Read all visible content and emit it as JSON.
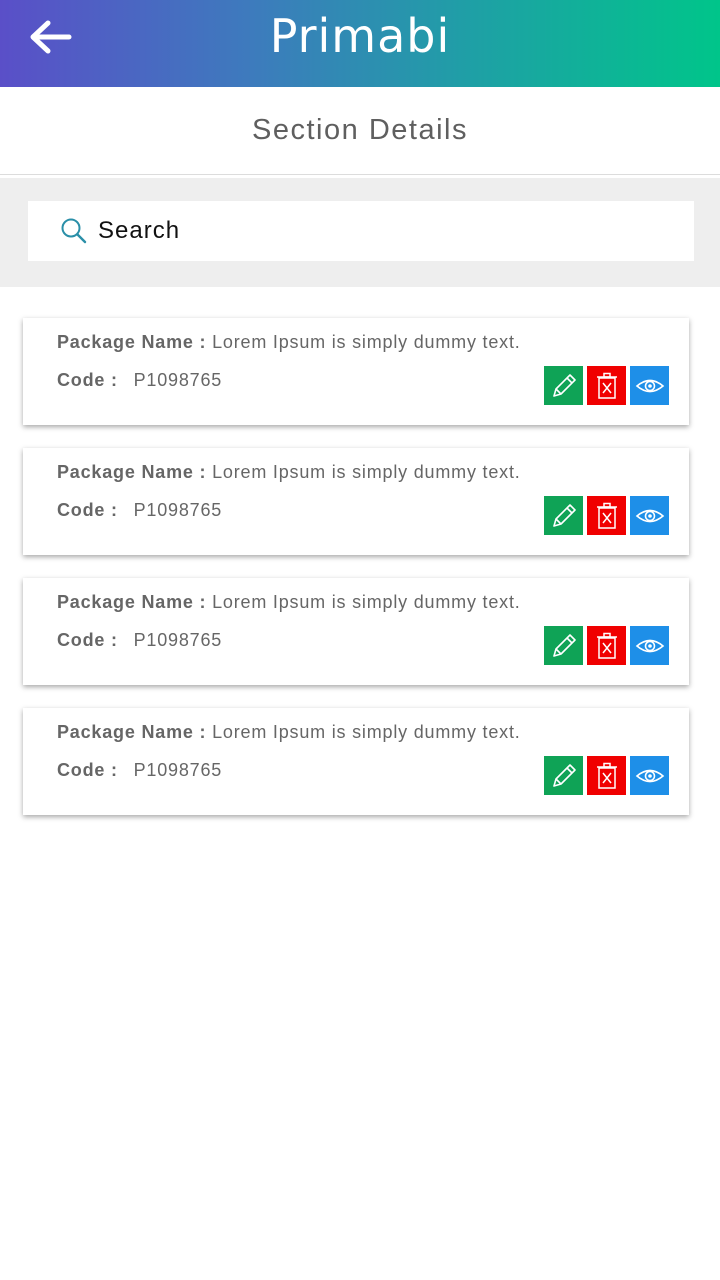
{
  "header": {
    "logo_text": "Primabi",
    "back_icon": "arrow-left-icon",
    "gradient": [
      "#5a4fc8",
      "#00c58a"
    ]
  },
  "page": {
    "title": "Section Details"
  },
  "search": {
    "placeholder": "Search",
    "value": "",
    "icon": "search-icon"
  },
  "labels": {
    "package_name": "Package Name :",
    "code": "Code :"
  },
  "actions": {
    "edit_color": "#0fa356",
    "delete_color": "#f00000",
    "view_color": "#1e8fe8",
    "edit_icon": "pencil-icon",
    "delete_icon": "trash-icon",
    "view_icon": "eye-icon"
  },
  "items": [
    {
      "package_name": "Lorem Ipsum is simply dummy text.",
      "code": "P1098765"
    },
    {
      "package_name": "Lorem Ipsum is simply dummy text.",
      "code": "P1098765"
    },
    {
      "package_name": "Lorem Ipsum is simply dummy text.",
      "code": "P1098765"
    },
    {
      "package_name": "Lorem Ipsum is simply dummy text.",
      "code": "P1098765"
    }
  ]
}
